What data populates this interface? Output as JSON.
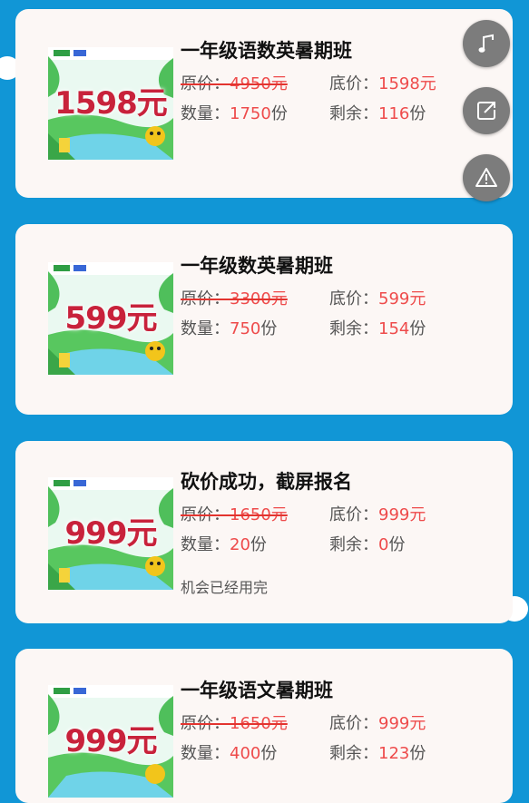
{
  "cards": [
    {
      "title": "一年级语数英暑期班",
      "price_big": "1598元",
      "orig_label": "原价：",
      "orig_price": "4950元",
      "floor_label": "底价：",
      "floor_price": "1598元",
      "qty_label": "数量：",
      "qty_value": "1750",
      "qty_unit": "份",
      "remain_label": "剩余：",
      "remain_value": "116",
      "remain_unit": "份"
    },
    {
      "title": "一年级数英暑期班",
      "price_big": "599元",
      "orig_label": "原价：",
      "orig_price": "3300元",
      "floor_label": "底价：",
      "floor_price": "599元",
      "qty_label": "数量：",
      "qty_value": "750",
      "qty_unit": "份",
      "remain_label": "剩余：",
      "remain_value": "154",
      "remain_unit": "份"
    },
    {
      "title": "砍价成功，截屏报名",
      "price_big": "999元",
      "orig_label": "原价：",
      "orig_price": "1650元",
      "floor_label": "底价：",
      "floor_price": "999元",
      "qty_label": "数量：",
      "qty_value": "20",
      "qty_unit": "份",
      "remain_label": "剩余：",
      "remain_value": "0",
      "remain_unit": "份",
      "note": "机会已经用完"
    },
    {
      "title": "一年级语文暑期班",
      "price_big": "999元",
      "orig_label": "原价：",
      "orig_price": "1650元",
      "floor_label": "底价：",
      "floor_price": "999元",
      "qty_label": "数量：",
      "qty_value": "400",
      "qty_unit": "份",
      "remain_label": "剩余：",
      "remain_value": "123",
      "remain_unit": "份"
    }
  ],
  "fabs": [
    {
      "icon": "music-note-icon"
    },
    {
      "icon": "share-icon"
    },
    {
      "icon": "warning-icon"
    }
  ],
  "colors": {
    "background": "#1196d6",
    "card": "#fcf7f5",
    "accent_red": "#ee4b4b",
    "price_big": "#c8223b",
    "fab": "#7c7c7c"
  }
}
